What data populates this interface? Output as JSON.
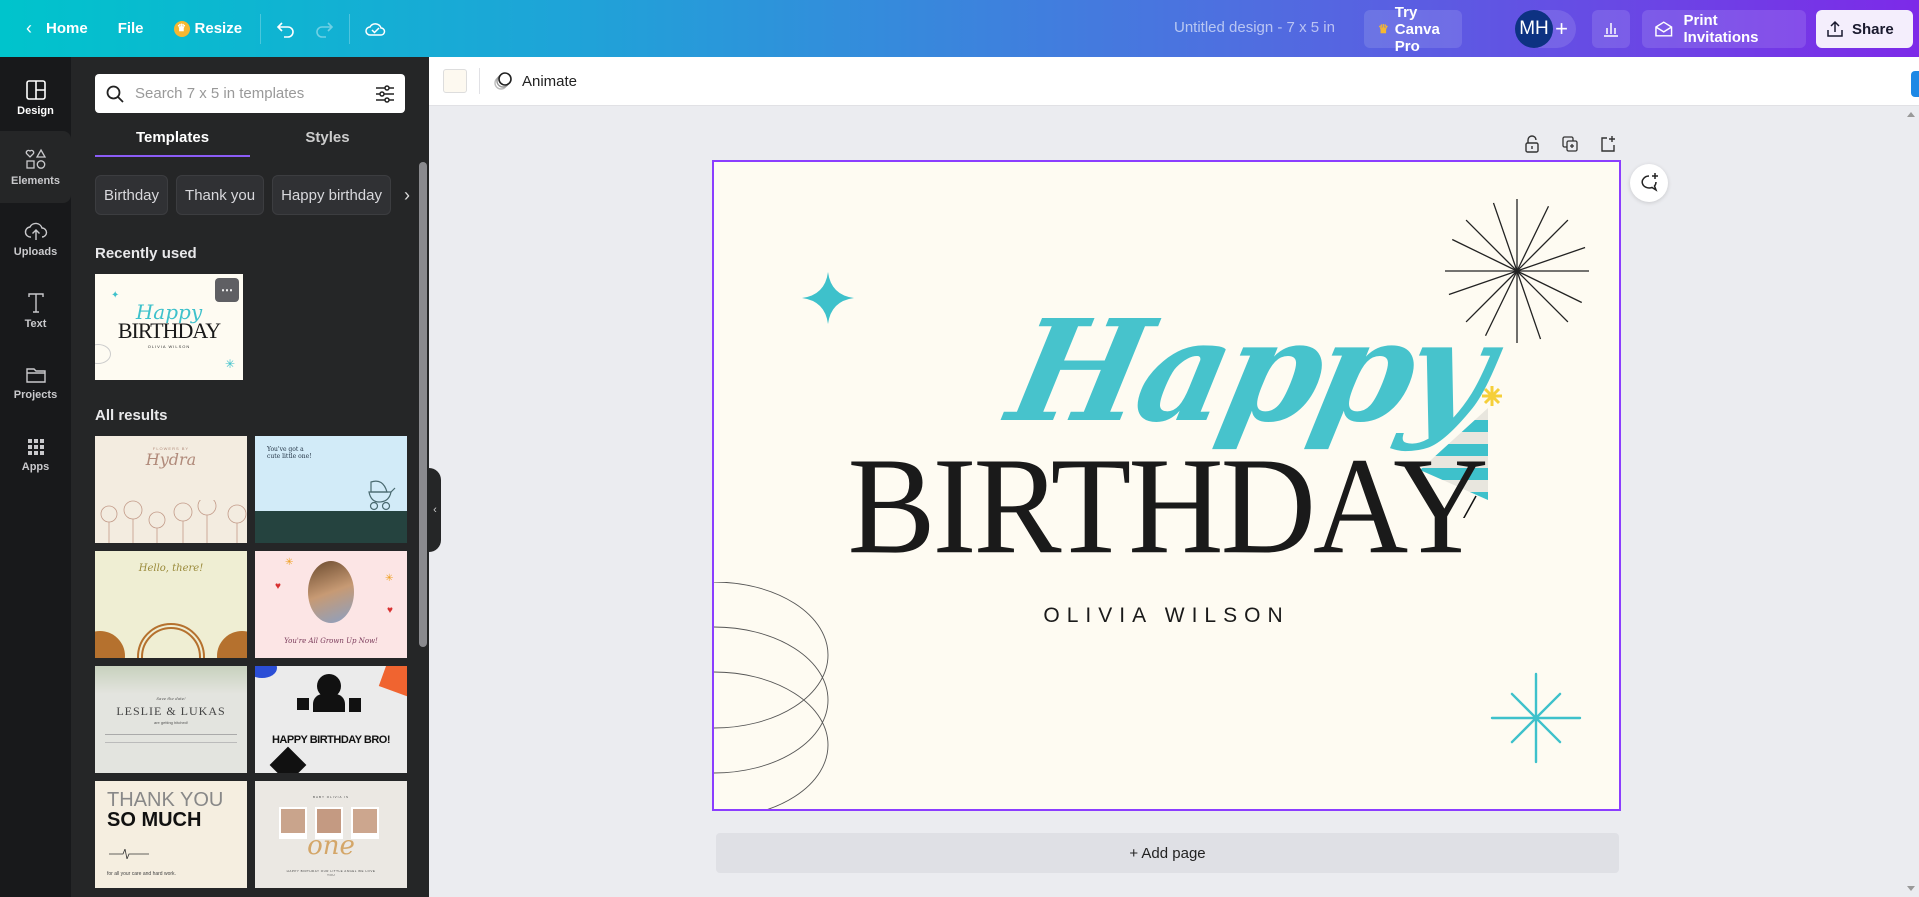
{
  "topbar": {
    "home_label": "Home",
    "file_label": "File",
    "resize_label": "Resize",
    "doc_title": "Untitled design - 7 x 5 in",
    "try_pro_label": "Try Canva Pro",
    "avatar_initials": "MH",
    "add_collaborator": "+",
    "print_label": "Print Invitations",
    "share_label": "Share"
  },
  "rail": {
    "items": [
      {
        "label": "Design"
      },
      {
        "label": "Elements"
      },
      {
        "label": "Uploads"
      },
      {
        "label": "Text"
      },
      {
        "label": "Projects"
      },
      {
        "label": "Apps"
      }
    ]
  },
  "panel": {
    "search_placeholder": "Search 7 x 5 in templates",
    "search_value": "",
    "tabs": [
      {
        "label": "Templates"
      },
      {
        "label": "Styles"
      }
    ],
    "chips": [
      {
        "label": "Birthday"
      },
      {
        "label": "Thank you"
      },
      {
        "label": "Happy birthday"
      }
    ],
    "recently_used_title": "Recently used",
    "all_results_title": "All results",
    "recent": {
      "line1": "Happy",
      "line2": "BIRTHDAY",
      "line3": "OLIVIA WILSON"
    },
    "templates": [
      {
        "name": "Flowers by Hydra",
        "small": "FLOWERS BY",
        "big": "Hydra"
      },
      {
        "name": "Cute little one",
        "text": "You've got a cute little one!"
      },
      {
        "name": "Hello there",
        "text": "Hello, there!"
      },
      {
        "name": "All grown up",
        "text": "You're All Grown Up Now!"
      },
      {
        "name": "Leslie & Lukas",
        "small": "Save the date!",
        "big": "LESLIE & LUKAS",
        "sub": "are getting hitched!"
      },
      {
        "name": "Happy birthday bro",
        "text": "HAPPY BIRTHDAY BRO!"
      },
      {
        "name": "Thank you so much",
        "line1": "THANK YOU",
        "line2": "SO MUCH",
        "sub": "for all your care and hard work."
      },
      {
        "name": "Baby Olivia is one",
        "small": "BABY OLIVIA IS",
        "big": "one",
        "sub": "HAPPY BIRTHDAY OUR LITTLE ANGEL WE LOVE YOU"
      }
    ]
  },
  "context_toolbar": {
    "bg_color": "#fdf9f0",
    "animate_label": "Animate"
  },
  "canvas": {
    "happy": "Happy",
    "birthday": "BIRTHDAY",
    "name": "OLIVIA WILSON",
    "accent_color": "#3ec1cb",
    "selection_color": "#8b3dff",
    "add_page_label": "+ Add page"
  }
}
